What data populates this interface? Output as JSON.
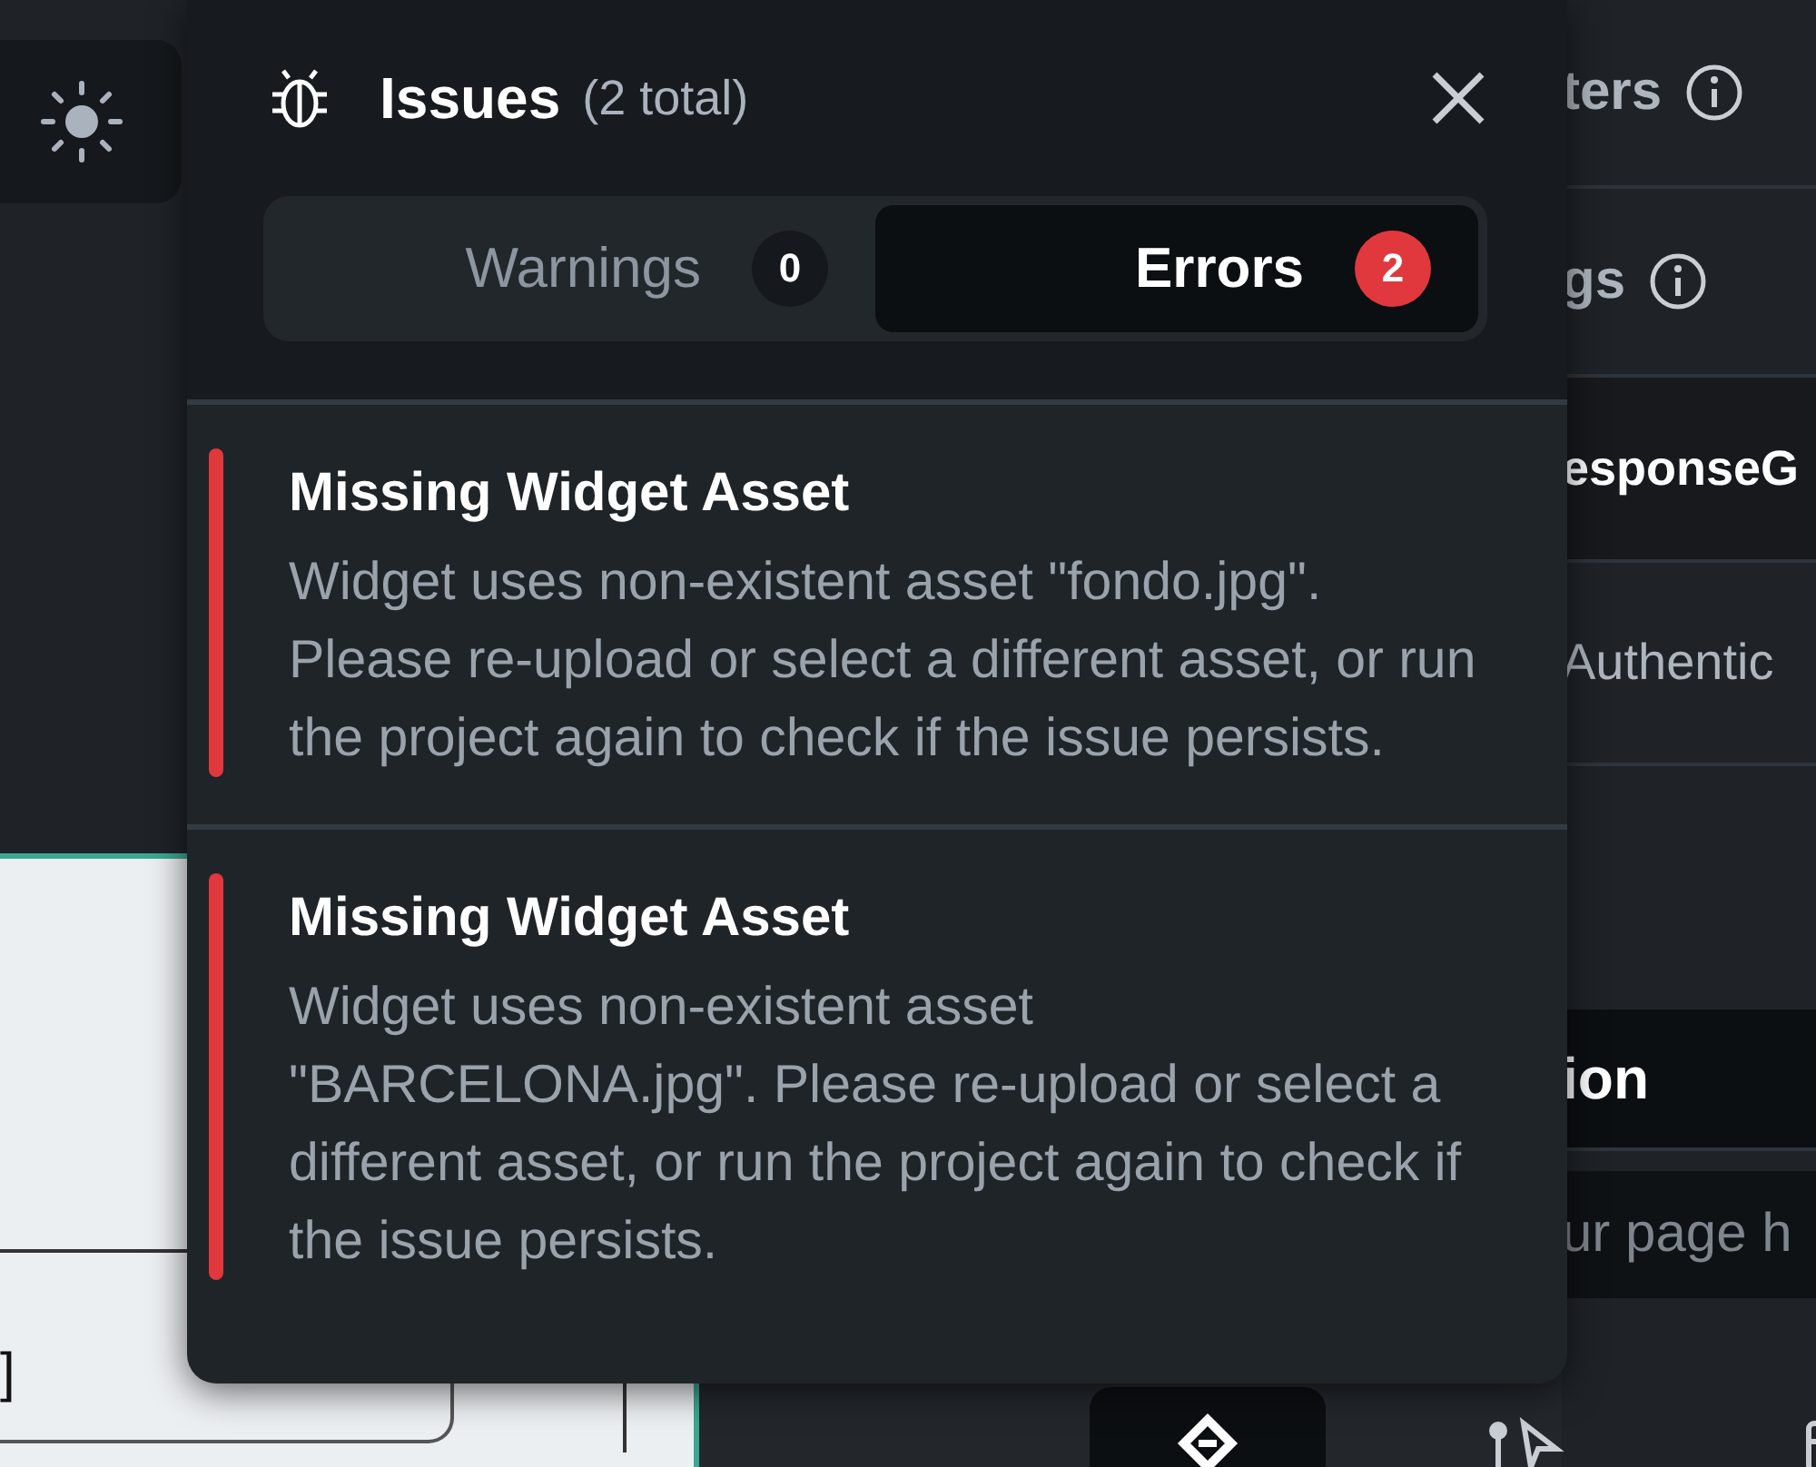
{
  "issues_panel": {
    "title": "Issues",
    "count": "(2 total)",
    "tabs": [
      {
        "label": "Warnings",
        "count": "0",
        "selected": false
      },
      {
        "label": "Errors",
        "count": "2",
        "selected": true
      }
    ],
    "issues": [
      {
        "title": "Missing Widget Asset",
        "description": "Widget uses non-existent asset \"fondo.jpg\". Please re-upload or select a different asset, or run the project again to check if the issue persists."
      },
      {
        "title": "Missing Widget Asset",
        "description": "Widget uses non-existent asset \"BARCELONA.jpg\". Please re-upload or select a different asset, or run the project again to check if the issue persists."
      }
    ]
  },
  "canvas": {
    "text": "]"
  },
  "properties_panel": {
    "rows": [
      {
        "kind": "heading",
        "text": "ters"
      },
      {
        "kind": "heading",
        "text": "gs"
      },
      {
        "kind": "value",
        "text": "esponseG"
      },
      {
        "kind": "muted",
        "text": "Authentic"
      },
      {
        "kind": "dark",
        "text": "ion"
      },
      {
        "kind": "field",
        "placeholder": "ur page h"
      }
    ]
  },
  "bottom_toolbar": {
    "items": [
      {
        "kind": "widget",
        "selected": true
      },
      {
        "kind": "pointer",
        "selected": false
      },
      {
        "kind": "table",
        "selected": false
      }
    ]
  }
}
